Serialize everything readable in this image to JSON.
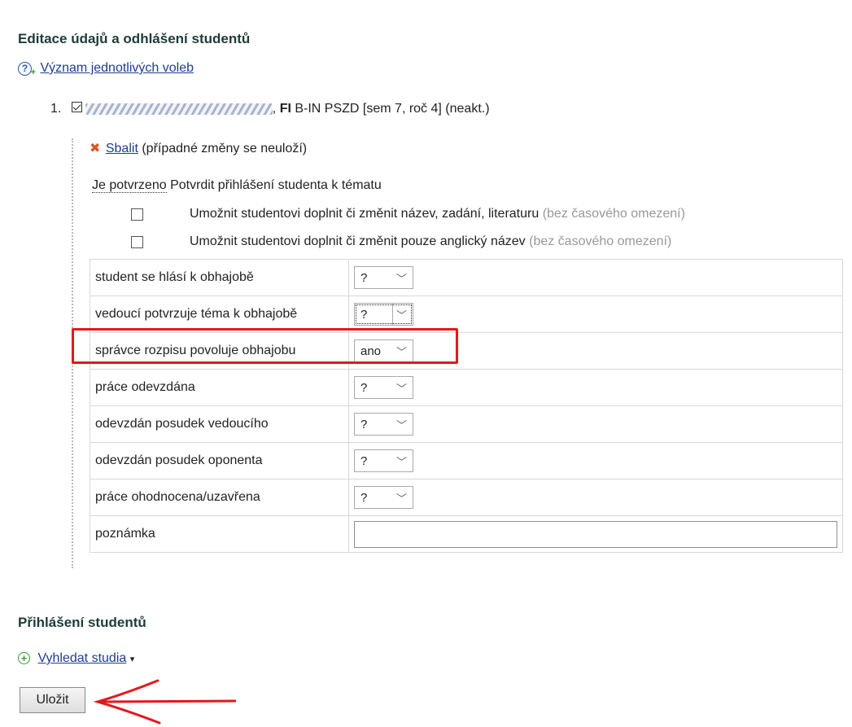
{
  "page": {
    "heading": "Editace údajů a odhlášení studentů",
    "help_link": "Význam jednotlivých voleb"
  },
  "student": {
    "number": "1.",
    "faculty": "FI",
    "study_info": "B-IN PSZD [sem 7, roč 4] (neakt.)",
    "collapse_link": "Sbalit",
    "collapse_note": "(případné změny se neuloží)",
    "confirmed_label": "Je potvrzeno",
    "confirm_text": "Potvrdit přihlášení studenta k tématu",
    "options": [
      {
        "text": "Umožnit studentovi doplnit či změnit název, zadání, literaturu",
        "hint": "(bez časového omezení)",
        "checked": false
      },
      {
        "text": "Umožnit studentovi doplnit či změnit pouze anglický název",
        "hint": "(bez časového omezení)",
        "checked": false
      }
    ],
    "rows": [
      {
        "label": "student se hlásí k obhajobě",
        "value": "?"
      },
      {
        "label": "vedoucí potvrzuje téma k obhajobě",
        "value": "?"
      },
      {
        "label": "správce rozpisu povoluje obhajobu",
        "value": "ano"
      },
      {
        "label": "práce odevzdána",
        "value": "?"
      },
      {
        "label": "odevzdán posudek vedoucího",
        "value": "?"
      },
      {
        "label": "odevzdán posudek oponenta",
        "value": "?"
      },
      {
        "label": "práce ohodnocena/uzavřena",
        "value": "?"
      },
      {
        "label": "poznámka",
        "value": ""
      }
    ]
  },
  "registration": {
    "heading": "Přihlášení studentů",
    "search_link": "Vyhledat studia",
    "save_label": "Uložit"
  },
  "colors": {
    "annotation_red": "#e0191f",
    "link": "#1f3d8c",
    "heading": "#1e3c37"
  },
  "icons": [
    "help-icon",
    "checkbox-checked-icon",
    "collapse-x-icon",
    "plus-circle-icon",
    "caret-down-icon",
    "chevron-down-icon",
    "red-arrow-annotation"
  ]
}
